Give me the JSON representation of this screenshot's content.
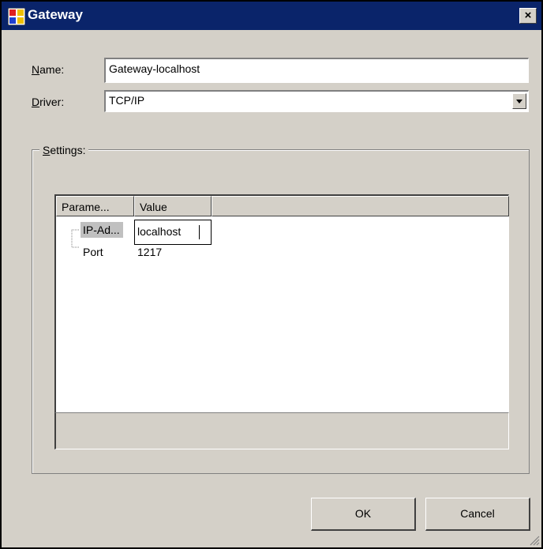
{
  "window": {
    "title": "Gateway",
    "close_glyph": "×",
    "icon": "app-window-icon"
  },
  "form": {
    "name_label_mnemonic": "N",
    "name_label_rest": "ame:",
    "name_value": "Gateway-localhost",
    "driver_label_mnemonic": "D",
    "driver_label_rest": "river:",
    "driver_value": "TCP/IP"
  },
  "settings": {
    "group_label_mnemonic": "S",
    "group_label_rest": "ettings:",
    "columns": [
      "Parame...",
      "Value"
    ],
    "rows": [
      {
        "parameter": "IP-Ad...",
        "value": "localhost"
      },
      {
        "parameter": "Port",
        "value": "1217"
      }
    ]
  },
  "buttons": {
    "ok": "OK",
    "cancel": "Cancel"
  },
  "colors": {
    "title_bar": "#0a246a",
    "dialog": "#d4d0c8",
    "selection": "#c0c0c0"
  }
}
